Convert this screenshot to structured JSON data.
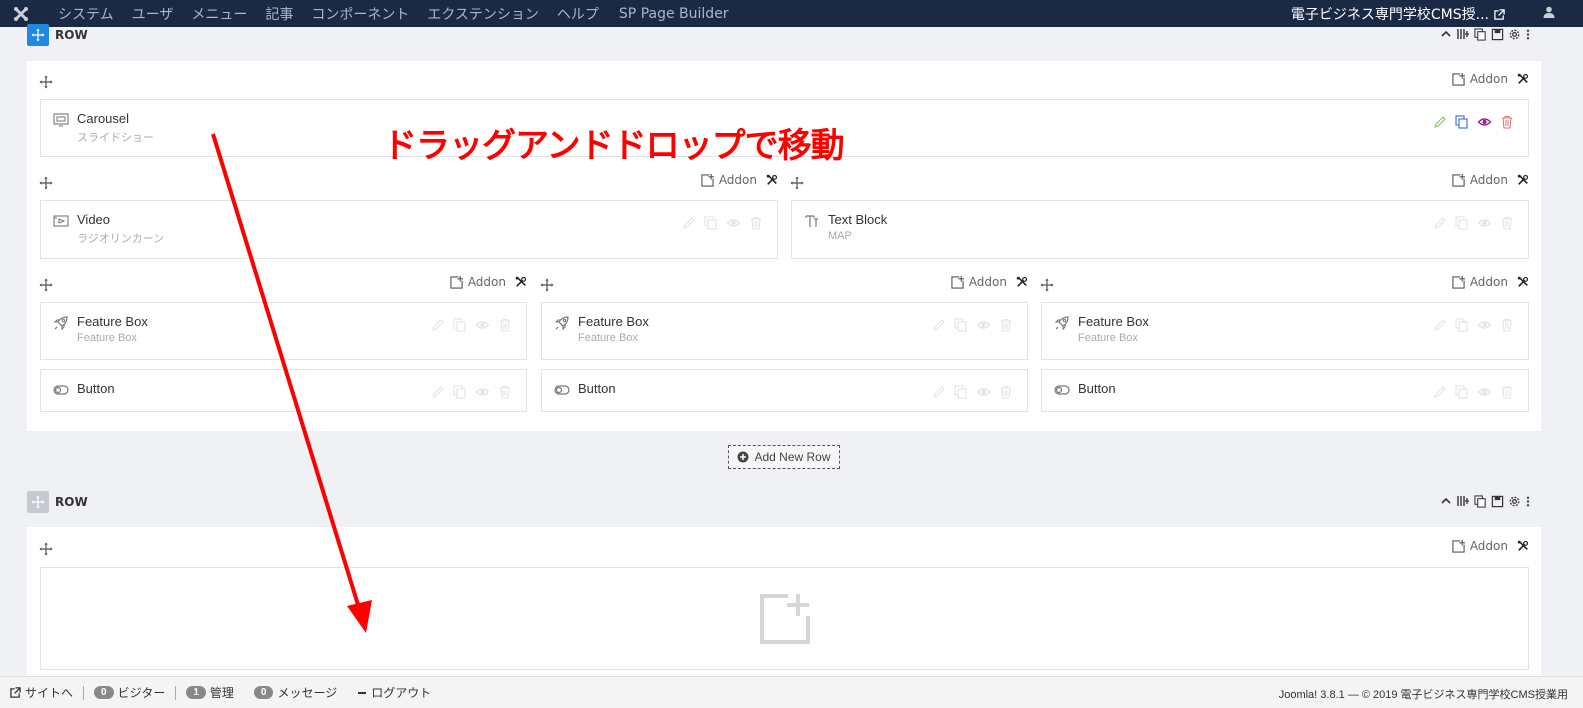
{
  "topbar": {
    "menu": [
      "システム",
      "ユーザ",
      "メニュー",
      "記事",
      "コンポーネント",
      "エクステンション",
      "ヘルプ"
    ],
    "page_builder": "SP Page Builder",
    "site_name": "電子ビジネス専門学校CMS授..."
  },
  "rows": [
    {
      "title": "ROW"
    },
    {
      "title": "ROW"
    }
  ],
  "addon_label": "Addon",
  "addons": {
    "carousel": {
      "name": "Carousel",
      "sub": "スライドショー"
    },
    "video": {
      "name": "Video",
      "sub": "ラジオリンカーン"
    },
    "text_block": {
      "name": "Text Block",
      "sub": "MAP"
    },
    "feature1": {
      "name": "Feature Box",
      "sub": "Feature Box"
    },
    "feature2": {
      "name": "Feature Box",
      "sub": "Feature Box"
    },
    "feature3": {
      "name": "Feature Box",
      "sub": "Feature Box"
    },
    "button1": {
      "name": "Button"
    },
    "button2": {
      "name": "Button"
    },
    "button3": {
      "name": "Button"
    }
  },
  "add_new_row": "Add New Row",
  "annotation": "ドラッグアンドドロップで移動",
  "colors": {
    "annotation": "#ff0000",
    "active_row": "#1e88e5",
    "navbar": "#1a2a44"
  },
  "statusbar": {
    "site": "サイトへ",
    "visitors_count": "0",
    "visitors": "ビジター",
    "admin_count": "1",
    "admin": "管理",
    "messages_count": "0",
    "messages": "メッセージ",
    "logout": "ログアウト",
    "footer": "Joomla! 3.8.1 — © 2019 電子ビジネス専門学校CMS授業用"
  }
}
